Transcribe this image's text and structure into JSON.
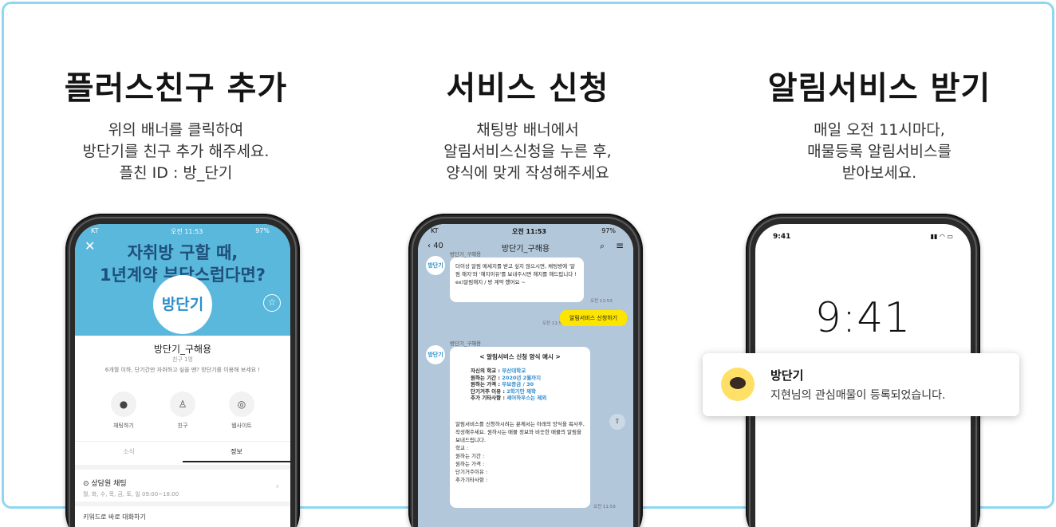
{
  "steps": [
    {
      "title": "플러스친구 추가",
      "lines": [
        "위의 배너를 클릭하여",
        "방단기를 친구 추가 해주세요.",
        "플친 ID : 방_단기"
      ]
    },
    {
      "title": "서비스 신청",
      "lines": [
        "채팅방 배너에서",
        "알림서비스신청을 누른 후,",
        "양식에 맞게 작성해주세요"
      ]
    },
    {
      "title": "알림서비스 받기",
      "lines": [
        "매일 오전 11시마다,",
        "매물등록 알림서비스를",
        "받아보세요."
      ]
    }
  ],
  "phone1": {
    "status_carrier": "KT",
    "status_time": "오전 11:53",
    "status_battery": "97%",
    "banner_lines": [
      "자취방 구할 때,",
      "1년계약 부담스럽다면?"
    ],
    "logo_text": "방단기",
    "profile_name": "방단기_구해용",
    "friend_count": "친구 1명",
    "intro": "6개월 이하, 단기간만 자취하고 싶을 땐? 방단기를 이용해 보세요 !",
    "actions": [
      "채팅하기",
      "친구",
      "웹사이트"
    ],
    "tabs": [
      "소식",
      "정보"
    ],
    "consult_title": "상담원 채팅",
    "consult_hours": "월, 화, 수, 목, 금, 토, 일 09:00~18:00",
    "keyword_label": "키워드로 바로 대화하기"
  },
  "phone2": {
    "status_carrier": "KT",
    "status_time": "오전 11:53",
    "status_battery": "97%",
    "back_count": "40",
    "chat_title": "방단기_구해용",
    "avatar_text": "방단기",
    "sender": "방단기_구해용",
    "bubble1": "더이상 알림 메세지를 받고 싶지 않으시면, 채팅방에 '알림 해지'와 '해지이유'를 보내주시면 해지를 해드립니다 ! ex)알림해지 / 방 계약 했어요 ~",
    "bubble1_time": "오전 11:53",
    "my_message": "알림서비스 신청하기",
    "my_time": "오전 11:53",
    "form_title": "< 알림서비스 신청 양식 예시 >",
    "form_rows": [
      {
        "label": "자신의 학교 : ",
        "value": "부산대학교"
      },
      {
        "label": "원하는 기간 : ",
        "value": "2020년 2월까지"
      },
      {
        "label": "원하는 가격 : ",
        "value": "무보증금 / 30"
      },
      {
        "label": "단기거주 이유 : ",
        "value": "2학기만 재학"
      },
      {
        "label": "추가 기타사항 : ",
        "value": "셰어하우스는 제외"
      }
    ],
    "bubble2_desc": "알림서비스를 신청하시려는 분께서는 아래의 양식을 복사후, 작성해주세요. 원하시는 매물 정보와 비슷한 매물의 알림을 보내드립니다.",
    "blank_fields": [
      "학교 :",
      "원하는 기간 :",
      "원하는 가격 :",
      "단기거주이유 :",
      "추가기타사항 :"
    ],
    "bubble2_time": "오전 11:53"
  },
  "phone3": {
    "status_time": "9:41",
    "clock": "9:41"
  },
  "notification": {
    "title": "방단기",
    "message": "지현님의 관심매물이 등록되었습니다."
  }
}
